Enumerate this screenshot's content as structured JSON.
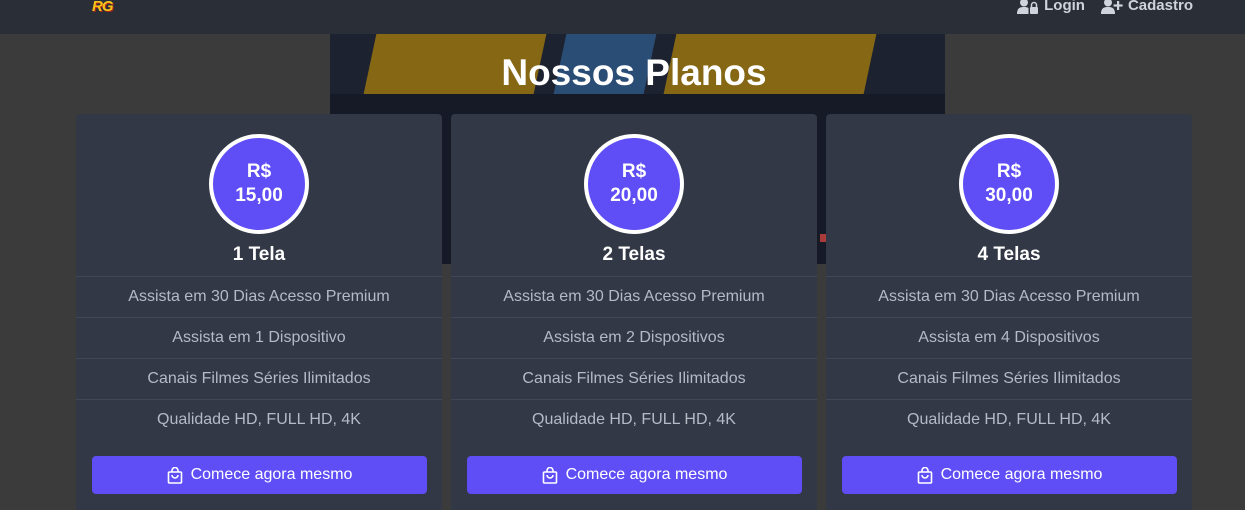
{
  "nav": {
    "logo_text": "RG",
    "login_label": "Login",
    "signup_label": "Cadastro"
  },
  "page_title": "Nossos Planos",
  "plans": [
    {
      "currency": "R$",
      "price": "15,00",
      "name": "1 Tela",
      "features": [
        "Assista em 30 Dias Acesso Premium",
        "Assista em 1 Dispositivo",
        "Canais Filmes Séries Ilimitados",
        "Qualidade HD, FULL HD, 4K"
      ],
      "cta_label": "Comece agora mesmo"
    },
    {
      "currency": "R$",
      "price": "20,00",
      "name": "2 Telas",
      "features": [
        "Assista em 30 Dias Acesso Premium",
        "Assista em 2 Dispositivos",
        "Canais Filmes Séries Ilimitados",
        "Qualidade HD, FULL HD, 4K"
      ],
      "cta_label": "Comece agora mesmo"
    },
    {
      "currency": "R$",
      "price": "30,00",
      "name": "4 Telas",
      "features": [
        "Assista em 30 Dias Acesso Premium",
        "Assista em 4 Dispositivos",
        "Canais Filmes Séries Ilimitados",
        "Qualidade HD, FULL HD, 4K"
      ],
      "cta_label": "Comece agora mesmo"
    }
  ],
  "colors": {
    "accent": "#5f4ef5",
    "card_bg": "#323845",
    "navbar_bg": "#2a2e37"
  },
  "icons": {
    "login": "user-lock-icon",
    "signup": "user-plus-icon",
    "cta": "shopping-bag-icon"
  }
}
